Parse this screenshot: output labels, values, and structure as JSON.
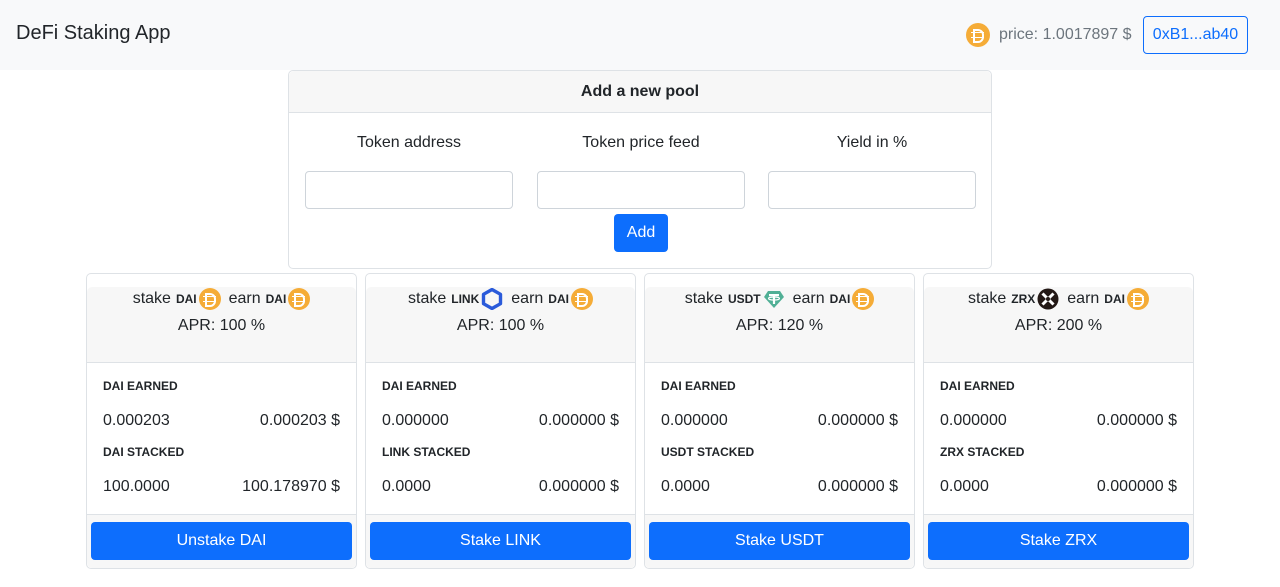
{
  "navbar": {
    "brand": "DeFi Staking App",
    "price_icon": "dai-coin-icon",
    "price_text": "price: 1.0017897 $",
    "wallet_label": "0xB1...ab40"
  },
  "add_pool": {
    "title": "Add a new pool",
    "fields": [
      {
        "label": "Token address",
        "value": "",
        "placeholder": ""
      },
      {
        "label": "Token price feed",
        "value": "",
        "placeholder": ""
      },
      {
        "label": "Yield in %",
        "value": "",
        "placeholder": ""
      }
    ],
    "add_label": "Add"
  },
  "colors": {
    "primary": "#0d6efd",
    "dai": "#f5ac37",
    "link": "#2a5ada",
    "usdt": "#50af95",
    "zrx": "#231815"
  },
  "pools": [
    {
      "stake_word": "stake",
      "stake_symbol": "DAI",
      "stake_icon": "dai-coin-icon",
      "earn_word": "earn",
      "earn_symbol": "DAI",
      "earn_icon": "dai-coin-icon",
      "apr": "APR: 100 %",
      "earned_label": "DAI EARNED",
      "earned_amount": "0.000203",
      "earned_usd": "0.000203 $",
      "staked_label": "DAI STACKED",
      "staked_amount": "100.0000",
      "staked_usd": "100.178970 $",
      "action_label": "Unstake DAI"
    },
    {
      "stake_word": "stake",
      "stake_symbol": "LINK",
      "stake_icon": "chainlink-hexagon-icon",
      "earn_word": "earn",
      "earn_symbol": "DAI",
      "earn_icon": "dai-coin-icon",
      "apr": "APR: 100 %",
      "earned_label": "DAI EARNED",
      "earned_amount": "0.000000",
      "earned_usd": "0.000000 $",
      "staked_label": "LINK STACKED",
      "staked_amount": "0.0000",
      "staked_usd": "0.000000 $",
      "action_label": "Stake LINK"
    },
    {
      "stake_word": "stake",
      "stake_symbol": "USDT",
      "stake_icon": "tether-icon",
      "earn_word": "earn",
      "earn_symbol": "DAI",
      "earn_icon": "dai-coin-icon",
      "apr": "APR: 120 %",
      "earned_label": "DAI EARNED",
      "earned_amount": "0.000000",
      "earned_usd": "0.000000 $",
      "staked_label": "USDT STACKED",
      "staked_amount": "0.0000",
      "staked_usd": "0.000000 $",
      "action_label": "Stake USDT"
    },
    {
      "stake_word": "stake",
      "stake_symbol": "ZRX",
      "stake_icon": "zrx-icon",
      "earn_word": "earn",
      "earn_symbol": "DAI",
      "earn_icon": "dai-coin-icon",
      "apr": "APR: 200 %",
      "earned_label": "DAI EARNED",
      "earned_amount": "0.000000",
      "earned_usd": "0.000000 $",
      "staked_label": "ZRX STACKED",
      "staked_amount": "0.0000",
      "staked_usd": "0.000000 $",
      "action_label": "Stake ZRX"
    }
  ]
}
